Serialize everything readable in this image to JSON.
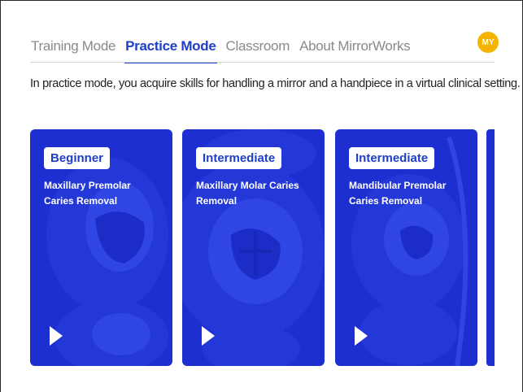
{
  "nav": {
    "tabs": [
      {
        "label": "Training Mode",
        "active": false
      },
      {
        "label": "Practice Mode",
        "active": true
      },
      {
        "label": "Classroom",
        "active": false
      },
      {
        "label": "About MirrorWorks",
        "active": false
      }
    ]
  },
  "avatar": {
    "initials": "MY",
    "color": "#f4b400"
  },
  "intro": "In practice mode, you acquire skills for handling a mirror and a handpiece in a virtual clinical setting.",
  "cards": [
    {
      "level": "Beginner",
      "title": "Maxillary Premolar Caries Removal",
      "icon": "play-icon"
    },
    {
      "level": "Intermediate",
      "title": "Maxillary Molar Caries Removal",
      "icon": "play-icon"
    },
    {
      "level": "Intermediate",
      "title": "Mandibular Premolar Caries Removal",
      "icon": "play-icon"
    }
  ],
  "colors": {
    "accent": "#1f3fc8",
    "card": "#1e2fd2",
    "muted_tab": "#8a8a8a"
  }
}
